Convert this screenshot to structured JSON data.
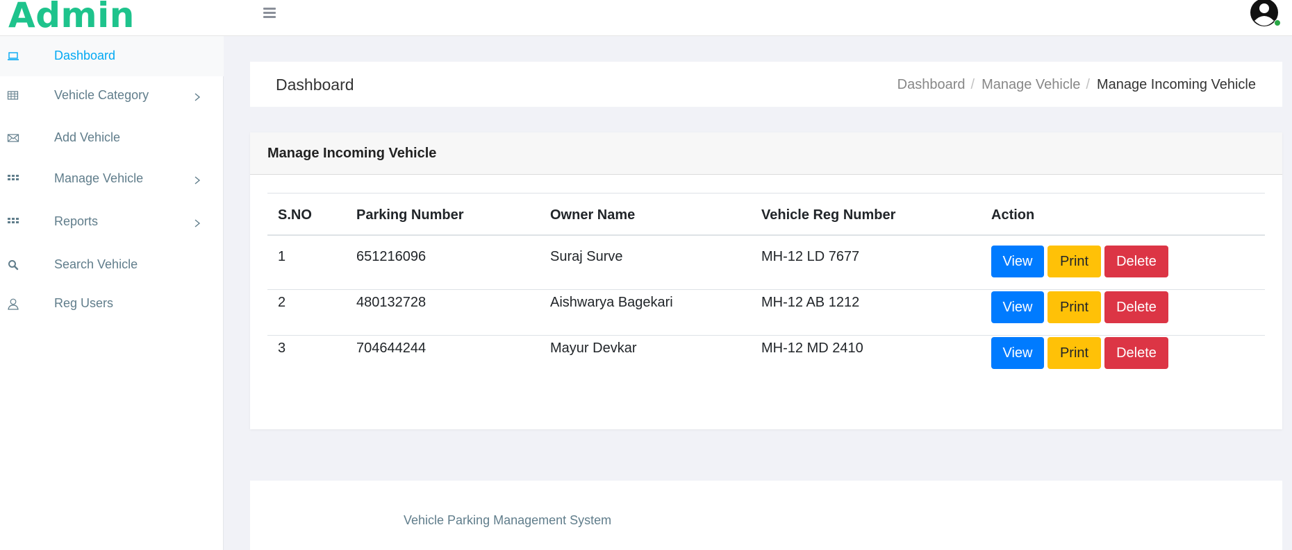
{
  "header": {
    "brand": "Admin",
    "menu_icon": "hamburger-icon",
    "avatar_icon": "user-avatar-icon",
    "status_color": "#28a745"
  },
  "sidebar": {
    "items": [
      {
        "label": "Dashboard",
        "icon": "laptop-icon",
        "active": true
      },
      {
        "label": "Vehicle Category",
        "icon": "table-icon",
        "has_submenu": true
      },
      {
        "label": "Add Vehicle",
        "icon": "envelope-icon"
      },
      {
        "label": "Manage Vehicle",
        "icon": "grid-icon",
        "has_submenu": true
      },
      {
        "label": "Reports",
        "icon": "grid-icon",
        "has_submenu": true
      },
      {
        "label": "Search Vehicle",
        "icon": "search-icon"
      },
      {
        "label": "Reg Users",
        "icon": "user-icon"
      }
    ]
  },
  "page_header": {
    "title": "Dashboard",
    "breadcrumb": [
      "Dashboard",
      "Manage Vehicle",
      "Manage Incoming Vehicle"
    ]
  },
  "card": {
    "title": "Manage Incoming Vehicle",
    "columns": [
      "S.NO",
      "Parking Number",
      "Owner Name",
      "Vehicle Reg Number",
      "Action"
    ],
    "rows": [
      {
        "sno": "1",
        "parking_number": "651216096",
        "owner_name": "Suraj Surve",
        "reg_number": "MH-12 LD 7677"
      },
      {
        "sno": "2",
        "parking_number": "480132728",
        "owner_name": "Aishwarya Bagekari",
        "reg_number": "MH-12 AB 1212"
      },
      {
        "sno": "3",
        "parking_number": "704644244",
        "owner_name": "Mayur Devkar",
        "reg_number": "MH-12 MD 2410"
      }
    ],
    "actions": {
      "view": "View",
      "print": "Print",
      "delete": "Delete"
    },
    "action_colors": {
      "view": "#007bff",
      "print": "#ffc107",
      "delete": "#dc3545"
    }
  },
  "footer": {
    "text": "Vehicle Parking Management System"
  },
  "colors": {
    "brand": "#1ec38c",
    "active_link": "#03a9f3",
    "sidebar_text": "#607d8b",
    "background": "#f1f2f7"
  }
}
